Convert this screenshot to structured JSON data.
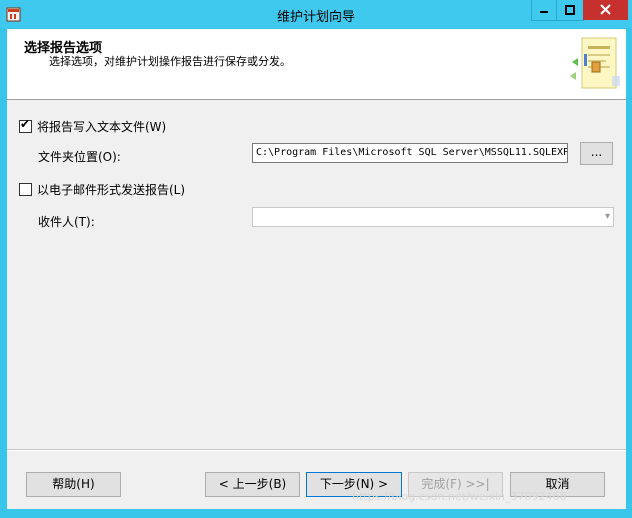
{
  "window": {
    "title": "维护计划向导"
  },
  "header": {
    "title": "选择报告选项",
    "subtitle": "选择选项，对维护计划操作报告进行保存或分发。"
  },
  "options": {
    "write_to_file": {
      "label": "将报告写入文本文件(W)",
      "checked": true
    },
    "folder_label": "文件夹位置(O):",
    "folder_value": "C:\\Program Files\\Microsoft SQL Server\\MSSQL11.SQLEXP",
    "browse_label": "...",
    "email": {
      "label": "以电子邮件形式发送报告(L)",
      "checked": false
    },
    "recipient_label": "收件人(T):",
    "recipient_value": ""
  },
  "buttons": {
    "help": "帮助(H)",
    "prev": "< 上一步(B)",
    "next": "下一步(N) >",
    "finish": "完成(F) >>|",
    "cancel": "取消"
  },
  "watermark": "https://blog.csdn.net/weixin_37092468",
  "colors": {
    "titlebar": "#3fc9ee",
    "close": "#c7312d",
    "focus": "#0078d7"
  }
}
